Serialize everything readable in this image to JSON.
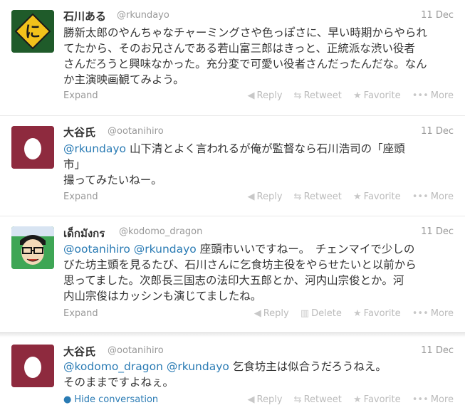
{
  "tweets": [
    {
      "name": "石川ある",
      "handle": "@rkundayo",
      "time": "11 Dec",
      "lines": [
        "勝新太郎のやんちゃなチャーミングさや色っぽさに、早い時期からやられ",
        "てたから、そのお兄さんである若山富三郎はきっと、正統派な渋い役者",
        "さんだろうと興味なかった。充分変で可愛い役者さんだったんだな。なん",
        "か主演映画観てみよう。"
      ],
      "expand": "Expand",
      "actions": [
        "Reply",
        "Retweet",
        "Favorite",
        "More"
      ],
      "avatar_text": "に"
    },
    {
      "name": "大谷氏",
      "handle": "@ootanihiro",
      "time": "11 Dec",
      "mention": "@rkundayo",
      "line1": " 山下清とよく言われるが俺が監督なら石川浩司の「座頭",
      "lines": [
        "市」",
        "撮ってみたいねー。"
      ],
      "expand": "Expand",
      "actions": [
        "Reply",
        "Retweet",
        "Favorite",
        "More"
      ]
    },
    {
      "name": "เด็กมังกร",
      "handle": "@kodomo_dragon",
      "time": "11 Dec",
      "mention1": "@ootanihiro",
      "mention2": "@rkundayo",
      "line1": " 座頭市いいですねー。　チェンマイで少しの",
      "lines": [
        "びた坊主頭を見るたび、石川さんに乞食坊主役をやらせたいと以前から",
        "思ってました。次郎長三国志の法印大五郎とか、河内山宗俊とか。河",
        "内山宗俊はカッシンも演じてましたね。"
      ],
      "expand": "Expand",
      "actions": [
        "Reply",
        "Delete",
        "Favorite",
        "More"
      ]
    },
    {
      "name": "大谷氏",
      "handle": "@ootanihiro",
      "time": "11 Dec",
      "mention1": "@kodomo_dragon",
      "mention2": "@rkundayo",
      "line1": " 乞食坊主は似合うだろうねえ。",
      "lines": [
        "そのままですよねぇ。"
      ],
      "hide": "Hide conversation",
      "actions": [
        "Reply",
        "Retweet",
        "Favorite",
        "More"
      ]
    }
  ],
  "icons": {
    "reply": "reply-icon",
    "retweet": "retweet-icon",
    "delete": "trash-icon",
    "favorite": "star-icon",
    "more": "more-icon",
    "hide": "speech-bubble-icon"
  },
  "colors": {
    "link": "#2a7bb4",
    "muted": "#999999",
    "actions": "#bbbbbb",
    "egg_bg": "#8e2a3e",
    "avatar1_bg": "#1f5b2a",
    "avatar1_sign": "#f2c21b"
  }
}
